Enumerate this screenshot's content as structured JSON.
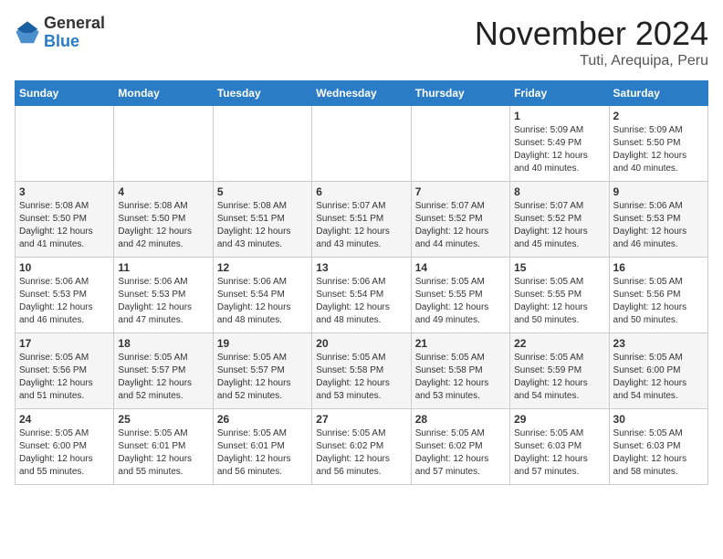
{
  "header": {
    "logo_general": "General",
    "logo_blue": "Blue",
    "month_title": "November 2024",
    "location": "Tuti, Arequipa, Peru"
  },
  "days_of_week": [
    "Sunday",
    "Monday",
    "Tuesday",
    "Wednesday",
    "Thursday",
    "Friday",
    "Saturday"
  ],
  "weeks": [
    [
      {
        "day": "",
        "data": ""
      },
      {
        "day": "",
        "data": ""
      },
      {
        "day": "",
        "data": ""
      },
      {
        "day": "",
        "data": ""
      },
      {
        "day": "",
        "data": ""
      },
      {
        "day": "1",
        "data": "Sunrise: 5:09 AM\nSunset: 5:49 PM\nDaylight: 12 hours\nand 40 minutes."
      },
      {
        "day": "2",
        "data": "Sunrise: 5:09 AM\nSunset: 5:50 PM\nDaylight: 12 hours\nand 40 minutes."
      }
    ],
    [
      {
        "day": "3",
        "data": "Sunrise: 5:08 AM\nSunset: 5:50 PM\nDaylight: 12 hours\nand 41 minutes."
      },
      {
        "day": "4",
        "data": "Sunrise: 5:08 AM\nSunset: 5:50 PM\nDaylight: 12 hours\nand 42 minutes."
      },
      {
        "day": "5",
        "data": "Sunrise: 5:08 AM\nSunset: 5:51 PM\nDaylight: 12 hours\nand 43 minutes."
      },
      {
        "day": "6",
        "data": "Sunrise: 5:07 AM\nSunset: 5:51 PM\nDaylight: 12 hours\nand 43 minutes."
      },
      {
        "day": "7",
        "data": "Sunrise: 5:07 AM\nSunset: 5:52 PM\nDaylight: 12 hours\nand 44 minutes."
      },
      {
        "day": "8",
        "data": "Sunrise: 5:07 AM\nSunset: 5:52 PM\nDaylight: 12 hours\nand 45 minutes."
      },
      {
        "day": "9",
        "data": "Sunrise: 5:06 AM\nSunset: 5:53 PM\nDaylight: 12 hours\nand 46 minutes."
      }
    ],
    [
      {
        "day": "10",
        "data": "Sunrise: 5:06 AM\nSunset: 5:53 PM\nDaylight: 12 hours\nand 46 minutes."
      },
      {
        "day": "11",
        "data": "Sunrise: 5:06 AM\nSunset: 5:53 PM\nDaylight: 12 hours\nand 47 minutes."
      },
      {
        "day": "12",
        "data": "Sunrise: 5:06 AM\nSunset: 5:54 PM\nDaylight: 12 hours\nand 48 minutes."
      },
      {
        "day": "13",
        "data": "Sunrise: 5:06 AM\nSunset: 5:54 PM\nDaylight: 12 hours\nand 48 minutes."
      },
      {
        "day": "14",
        "data": "Sunrise: 5:05 AM\nSunset: 5:55 PM\nDaylight: 12 hours\nand 49 minutes."
      },
      {
        "day": "15",
        "data": "Sunrise: 5:05 AM\nSunset: 5:55 PM\nDaylight: 12 hours\nand 50 minutes."
      },
      {
        "day": "16",
        "data": "Sunrise: 5:05 AM\nSunset: 5:56 PM\nDaylight: 12 hours\nand 50 minutes."
      }
    ],
    [
      {
        "day": "17",
        "data": "Sunrise: 5:05 AM\nSunset: 5:56 PM\nDaylight: 12 hours\nand 51 minutes."
      },
      {
        "day": "18",
        "data": "Sunrise: 5:05 AM\nSunset: 5:57 PM\nDaylight: 12 hours\nand 52 minutes."
      },
      {
        "day": "19",
        "data": "Sunrise: 5:05 AM\nSunset: 5:57 PM\nDaylight: 12 hours\nand 52 minutes."
      },
      {
        "day": "20",
        "data": "Sunrise: 5:05 AM\nSunset: 5:58 PM\nDaylight: 12 hours\nand 53 minutes."
      },
      {
        "day": "21",
        "data": "Sunrise: 5:05 AM\nSunset: 5:58 PM\nDaylight: 12 hours\nand 53 minutes."
      },
      {
        "day": "22",
        "data": "Sunrise: 5:05 AM\nSunset: 5:59 PM\nDaylight: 12 hours\nand 54 minutes."
      },
      {
        "day": "23",
        "data": "Sunrise: 5:05 AM\nSunset: 6:00 PM\nDaylight: 12 hours\nand 54 minutes."
      }
    ],
    [
      {
        "day": "24",
        "data": "Sunrise: 5:05 AM\nSunset: 6:00 PM\nDaylight: 12 hours\nand 55 minutes."
      },
      {
        "day": "25",
        "data": "Sunrise: 5:05 AM\nSunset: 6:01 PM\nDaylight: 12 hours\nand 55 minutes."
      },
      {
        "day": "26",
        "data": "Sunrise: 5:05 AM\nSunset: 6:01 PM\nDaylight: 12 hours\nand 56 minutes."
      },
      {
        "day": "27",
        "data": "Sunrise: 5:05 AM\nSunset: 6:02 PM\nDaylight: 12 hours\nand 56 minutes."
      },
      {
        "day": "28",
        "data": "Sunrise: 5:05 AM\nSunset: 6:02 PM\nDaylight: 12 hours\nand 57 minutes."
      },
      {
        "day": "29",
        "data": "Sunrise: 5:05 AM\nSunset: 6:03 PM\nDaylight: 12 hours\nand 57 minutes."
      },
      {
        "day": "30",
        "data": "Sunrise: 5:05 AM\nSunset: 6:03 PM\nDaylight: 12 hours\nand 58 minutes."
      }
    ]
  ]
}
